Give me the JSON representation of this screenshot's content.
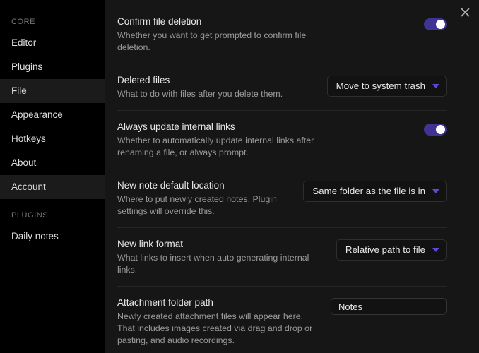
{
  "window": {
    "close_icon": "close-icon"
  },
  "sidebar": {
    "sections": [
      {
        "title": "CORE",
        "items": [
          {
            "label": "Editor",
            "state": "normal"
          },
          {
            "label": "Plugins",
            "state": "normal"
          },
          {
            "label": "File",
            "state": "active"
          },
          {
            "label": "Appearance",
            "state": "normal"
          },
          {
            "label": "Hotkeys",
            "state": "normal"
          },
          {
            "label": "About",
            "state": "normal"
          },
          {
            "label": "Account",
            "state": "hovered"
          }
        ]
      },
      {
        "title": "PLUGINS",
        "items": [
          {
            "label": "Daily notes",
            "state": "normal"
          }
        ]
      }
    ]
  },
  "settings": [
    {
      "name": "Confirm file deletion",
      "description": "Whether you want to get prompted to confirm file deletion.",
      "control": "toggle",
      "value": "on"
    },
    {
      "name": "Deleted files",
      "description": "What to do with files after you delete them.",
      "control": "dropdown",
      "value": "Move to system trash"
    },
    {
      "name": "Always update internal links",
      "description": "Whether to automatically update internal links after renaming a file, or always prompt.",
      "control": "toggle",
      "value": "on"
    },
    {
      "name": "New note default location",
      "description": "Where to put newly created notes. Plugin settings will override this.",
      "control": "dropdown",
      "value": "Same folder as the file is in"
    },
    {
      "name": "New link format",
      "description": "What links to insert when auto generating internal links.",
      "control": "dropdown",
      "value": "Relative path to file"
    },
    {
      "name": "Attachment folder path",
      "description": "Newly created attachment files will appear here. That includes images created via drag and drop or pasting, and audio recordings.",
      "control": "text",
      "value": "Notes",
      "placeholder": "Notes"
    }
  ],
  "colors": {
    "accent": "#3f3494",
    "chevron": "#5b4bd4",
    "sidebar_bg": "#000000",
    "main_bg": "#161616",
    "divider": "#262626"
  }
}
